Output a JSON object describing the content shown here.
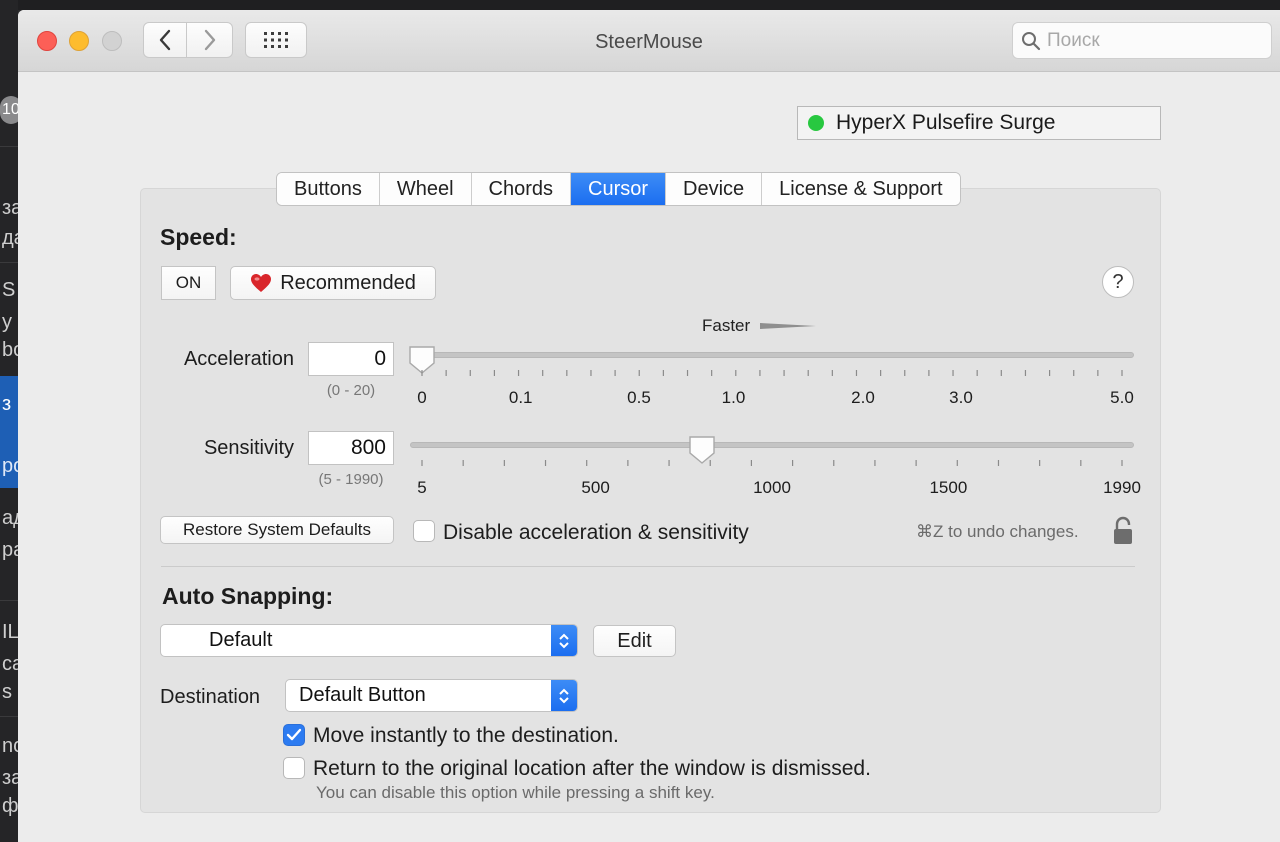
{
  "background_app": {
    "badge": "10",
    "fragments": [
      "за",
      "да",
      "S",
      "у",
      "bo",
      "з",
      "ро",
      "ад",
      "ра",
      "IL",
      "са",
      "s",
      "nc",
      "за",
      "ф"
    ]
  },
  "window": {
    "title": "SteerMouse",
    "search": {
      "placeholder": "Поиск",
      "value": ""
    }
  },
  "device": {
    "name": "HyperX Pulsefire Surge",
    "status_color": "#28c840"
  },
  "tabs": [
    {
      "label": "Buttons",
      "active": false
    },
    {
      "label": "Wheel",
      "active": false
    },
    {
      "label": "Chords",
      "active": false
    },
    {
      "label": "Cursor",
      "active": true
    },
    {
      "label": "Device",
      "active": false
    },
    {
      "label": "License & Support",
      "active": false
    }
  ],
  "speed": {
    "heading": "Speed:",
    "toggle_label": "ON",
    "recommended_label": "Recommended",
    "help_label": "?",
    "faster_label": "Faster",
    "acceleration": {
      "label": "Acceleration",
      "value": "0",
      "range_hint": "(0 - 20)",
      "slider_value": 0,
      "slider_min": 0,
      "slider_max": 5.0,
      "tick_labels": [
        "0",
        "0.1",
        "0.5",
        "1.0",
        "2.0",
        "3.0",
        "5.0"
      ]
    },
    "sensitivity": {
      "label": "Sensitivity",
      "value": "800",
      "range_hint": "(5 - 1990)",
      "slider_value": 800,
      "slider_min": 5,
      "slider_max": 1990,
      "tick_labels": [
        "5",
        "500",
        "1000",
        "1500",
        "1990"
      ]
    },
    "restore_label": "Restore System Defaults",
    "disable_label": "Disable acceleration & sensitivity",
    "disable_checked": false,
    "undo_hint": "⌘Z to undo changes."
  },
  "auto_snapping": {
    "heading": "Auto Snapping:",
    "selected": "Default",
    "edit_label": "Edit",
    "destination_label": "Destination",
    "destination_value": "Default Button",
    "move_instantly_label": "Move instantly to the destination.",
    "move_instantly_checked": true,
    "return_label": "Return to the original location after the window is dismissed.",
    "return_checked": false,
    "return_hint": "You can disable this option while pressing a shift key."
  }
}
